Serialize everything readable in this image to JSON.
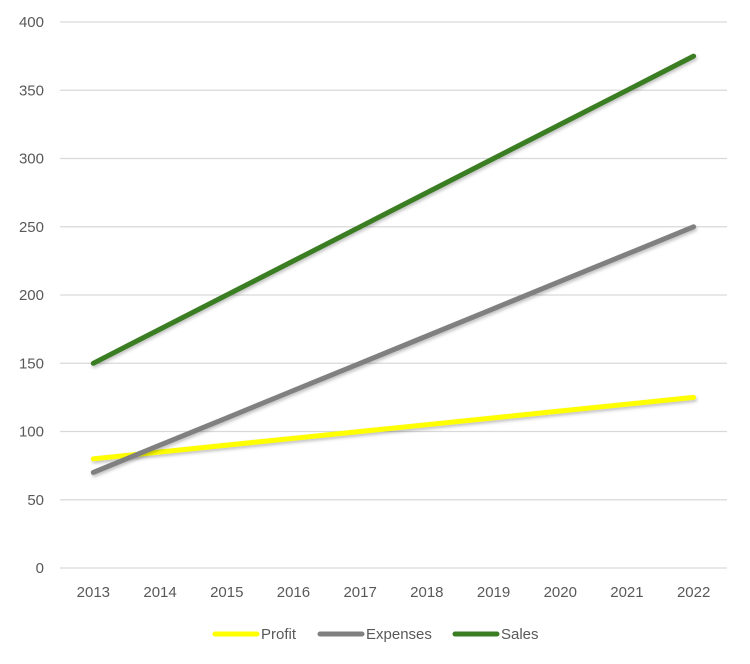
{
  "chart_data": {
    "type": "line",
    "title": "",
    "xlabel": "",
    "ylabel": "",
    "categories": [
      "2013",
      "2014",
      "2015",
      "2016",
      "2017",
      "2018",
      "2019",
      "2020",
      "2021",
      "2022"
    ],
    "ylim": [
      0,
      400
    ],
    "yticks": [
      0,
      50,
      100,
      150,
      200,
      250,
      300,
      350,
      400
    ],
    "ytick_labels": [
      "0",
      "50",
      "100",
      "150",
      "200",
      "250",
      "300",
      "350",
      "400"
    ],
    "grid": true,
    "legend_position": "bottom",
    "series": [
      {
        "name": "Profit",
        "color": "#FFFF00",
        "values": [
          80,
          85,
          90,
          95,
          100,
          105,
          110,
          115,
          120,
          125
        ]
      },
      {
        "name": "Expenses",
        "color": "#808080",
        "values": [
          70,
          90,
          110,
          130,
          150,
          170,
          190,
          210,
          230,
          250
        ]
      },
      {
        "name": "Sales",
        "color": "#3A7D22",
        "values": [
          150,
          175,
          200,
          225,
          250,
          275,
          300,
          325,
          350,
          375
        ]
      }
    ]
  }
}
